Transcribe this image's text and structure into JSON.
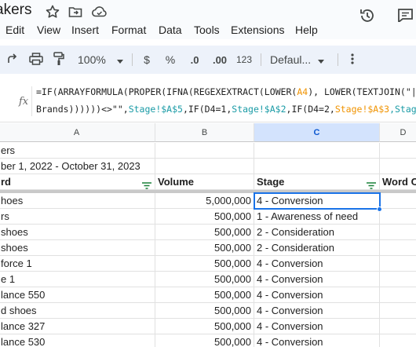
{
  "app": {
    "doc_title": "akers",
    "icons": [
      "star-icon",
      "move-to-folder-icon",
      "cloud-status-icon",
      "version-history-icon",
      "comment-icon"
    ]
  },
  "menu": [
    "Edit",
    "View",
    "Insert",
    "Format",
    "Data",
    "Tools",
    "Extensions",
    "Help"
  ],
  "toolbar": {
    "zoom": "100%",
    "currency": "$",
    "percent": "%",
    "decrease_decimal": ".0",
    "increase_decimal": ".00",
    "number_format": "123",
    "font": "Defaul...",
    "icons": [
      "redo-icon",
      "print-icon",
      "paint-format-icon",
      "zoom-dropdown-icon",
      "font-dropdown-icon",
      "more-options-icon"
    ]
  },
  "formula": {
    "fx_label": "fx",
    "line1": [
      {
        "t": "=IF(ARRAYFORMULA(PROPER(IFNA(REGEXEXTRACT(LOWER(",
        "c": "default"
      },
      {
        "t": "A4",
        "c": "orange"
      },
      {
        "t": "), LOWER(TEXTJOIN(\"|\"",
        "c": "default"
      }
    ],
    "line2": [
      {
        "t": "Brands))))))<>\"\",",
        "c": "default"
      },
      {
        "t": "Stage!$A$5",
        "c": "teal"
      },
      {
        "t": ",IF(D4=1,",
        "c": "default"
      },
      {
        "t": "Stage!$A$2",
        "c": "teal"
      },
      {
        "t": ",IF(D4=2,",
        "c": "default"
      },
      {
        "t": "Stage!$A$3",
        "c": "orange"
      },
      {
        "t": ",Stage",
        "c": "teal"
      }
    ]
  },
  "grid": {
    "columns": [
      "A",
      "B",
      "C",
      "D"
    ],
    "selected_column": "C",
    "rows": [
      [
        "ers",
        "",
        "",
        ""
      ],
      [
        "ber 1, 2022 - October 31, 2023",
        "",
        "",
        ""
      ],
      [
        "rd",
        "Volume",
        "Stage",
        "Word C"
      ],
      [
        "hoes",
        "5,000,000",
        "4 - Conversion",
        ""
      ],
      [
        "rs",
        "500,000",
        "1 - Awareness of need",
        ""
      ],
      [
        "shoes",
        "500,000",
        "2 - Consideration",
        ""
      ],
      [
        " shoes",
        "500,000",
        "2 - Consideration",
        ""
      ],
      [
        " force 1",
        "500,000",
        "4 - Conversion",
        ""
      ],
      [
        "e 1",
        "500,000",
        "4 - Conversion",
        ""
      ],
      [
        "lance 550",
        "500,000",
        "4 - Conversion",
        ""
      ],
      [
        "d shoes",
        "500,000",
        "4 - Conversion",
        ""
      ],
      [
        "lance 327",
        "500,000",
        "4 - Conversion",
        ""
      ],
      [
        "lance 530",
        "500,000",
        "4 - Conversion",
        ""
      ]
    ],
    "header_row_index": 2,
    "filtered_columns": [
      "A",
      "C"
    ]
  },
  "colors": {
    "selection": "#1a73e8",
    "toolbar_bg": "#edf2fa",
    "header_selected": "#d3e3fd",
    "formula_orange": "#f09300",
    "formula_teal": "#1a9ba6"
  }
}
